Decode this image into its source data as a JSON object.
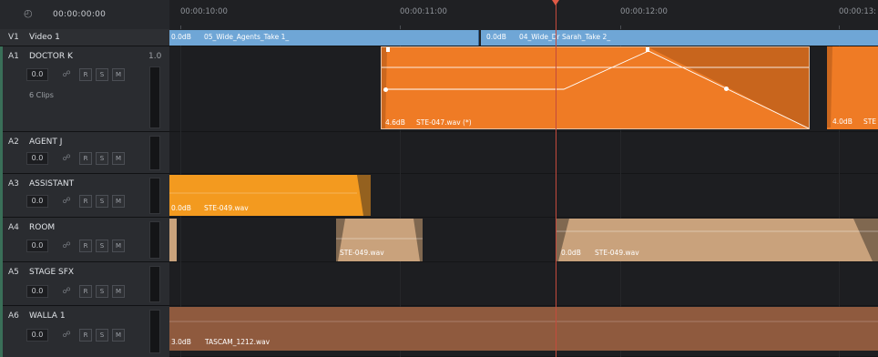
{
  "timecode": {
    "current": "00:00:00:00",
    "icon": "clock-icon"
  },
  "ruler": {
    "labels": [
      "00:00:10:00",
      "00:00:11:00",
      "00:00:12:00",
      "00:00:13:"
    ]
  },
  "tracks": [
    {
      "id": "V1",
      "name": "Video 1",
      "type": "video"
    },
    {
      "id": "A1",
      "name": "DOCTOR K",
      "vol_tag": "1.0",
      "level": "0.0",
      "info": "6 Clips"
    },
    {
      "id": "A2",
      "name": "AGENT J",
      "level": "0.0"
    },
    {
      "id": "A3",
      "name": "ASSISTANT",
      "level": "0.0"
    },
    {
      "id": "A4",
      "name": "ROOM",
      "level": "0.0"
    },
    {
      "id": "A5",
      "name": "STAGE SFX",
      "level": "0.0"
    },
    {
      "id": "A6",
      "name": "WALLA 1",
      "level": "0.0"
    }
  ],
  "buttons": {
    "r": "R",
    "s": "S",
    "m": "M"
  },
  "clips": {
    "v1_a": {
      "gain": "0.0dB",
      "name": "05_Wide_Agents_Take 1_"
    },
    "v1_b": {
      "gain": "0.0dB",
      "name": "04_Wide_Dr Sarah_Take 2_"
    },
    "a1_a": {
      "gain": "4.6dB",
      "name": "STE-047.wav (*)"
    },
    "a1_b": {
      "gain": "4.0dB",
      "name": "STE"
    },
    "a3_a": {
      "gain": "0.0dB",
      "name": "STE-049.wav"
    },
    "a4_a": {
      "name": "STE-049.wav"
    },
    "a4_b": {
      "gain": "0.0dB",
      "name": "STE-049.wav"
    },
    "a6_a": {
      "gain": "3.0dB",
      "name": "TASCAM_1212.wav"
    }
  },
  "colors": {
    "v1_clip": "#6fa6d6",
    "dialog_clip": "#ef7b25",
    "assistant_clip": "#f39a1f",
    "room_clip": "#c9a27c",
    "walla_clip": "#8f5a3e",
    "playhead": "#c44a3c"
  }
}
